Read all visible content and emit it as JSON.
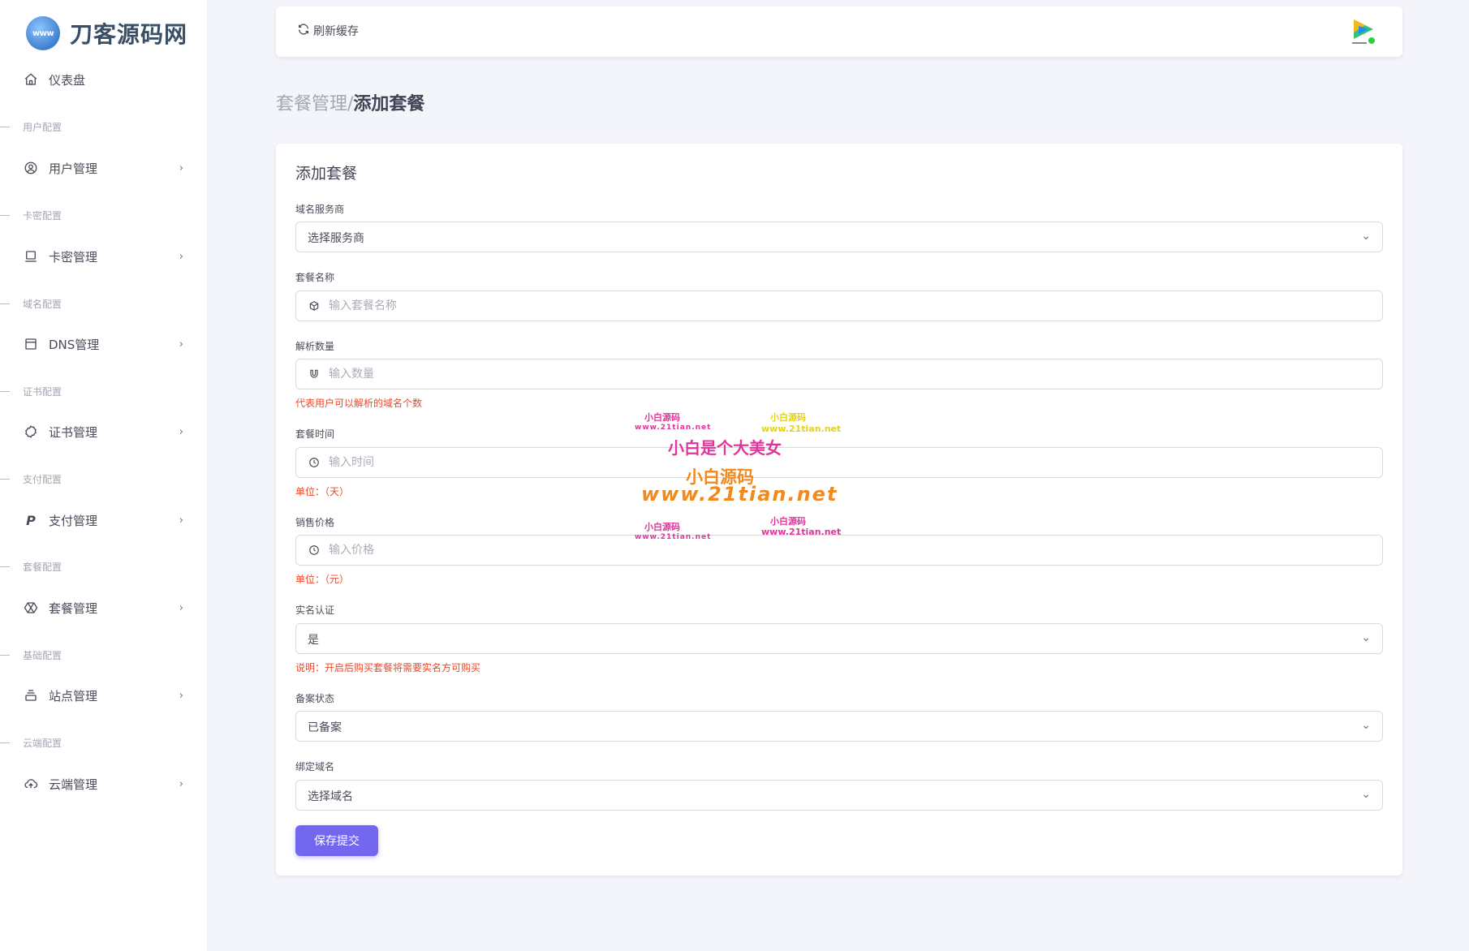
{
  "brand": {
    "logo_text": "www",
    "name": "刀客源码网"
  },
  "sidebar": {
    "dashboard": "仪表盘",
    "sections": [
      {
        "title": "用户配置",
        "item": "用户管理"
      },
      {
        "title": "卡密配置",
        "item": "卡密管理"
      },
      {
        "title": "域名配置",
        "item": "DNS管理"
      },
      {
        "title": "证书配置",
        "item": "证书管理"
      },
      {
        "title": "支付配置",
        "item": "支付管理"
      },
      {
        "title": "套餐配置",
        "item": "套餐管理"
      },
      {
        "title": "基础配置",
        "item": "站点管理"
      },
      {
        "title": "云端配置",
        "item": "云端管理"
      }
    ]
  },
  "topbar": {
    "refresh_label": "刷新缓存"
  },
  "breadcrumb": {
    "parent": "套餐管理/",
    "current": "添加套餐"
  },
  "form": {
    "title": "添加套餐",
    "provider": {
      "label": "域名服务商",
      "value": "选择服务商"
    },
    "name": {
      "label": "套餐名称",
      "placeholder": "输入套餐名称"
    },
    "count": {
      "label": "解析数量",
      "placeholder": "输入数量",
      "hint": "代表用户可以解析的域名个数"
    },
    "time": {
      "label": "套餐时间",
      "placeholder": "输入时间",
      "hint": "单位：（天）"
    },
    "price": {
      "label": "销售价格",
      "placeholder": "输入价格",
      "hint": "单位：（元）"
    },
    "realname": {
      "label": "实名认证",
      "value": "是",
      "hint": "说明：开启后购买套餐将需要实名方可购买"
    },
    "record": {
      "label": "备案状态",
      "value": "已备案"
    },
    "domain": {
      "label": "绑定域名",
      "value": "选择域名"
    },
    "submit_label": "保存提交"
  },
  "watermark": {
    "line1": "小白是个大美女",
    "line2": "小白源码",
    "line3": "www.21tian.net",
    "small_name": "小白源码",
    "small_url": "www.21tian.net"
  },
  "colors": {
    "accent": "#7367f0",
    "hint": "#ea4a2c",
    "watermark_pink": "#e0359b",
    "watermark_orange": "#f08a1e"
  }
}
